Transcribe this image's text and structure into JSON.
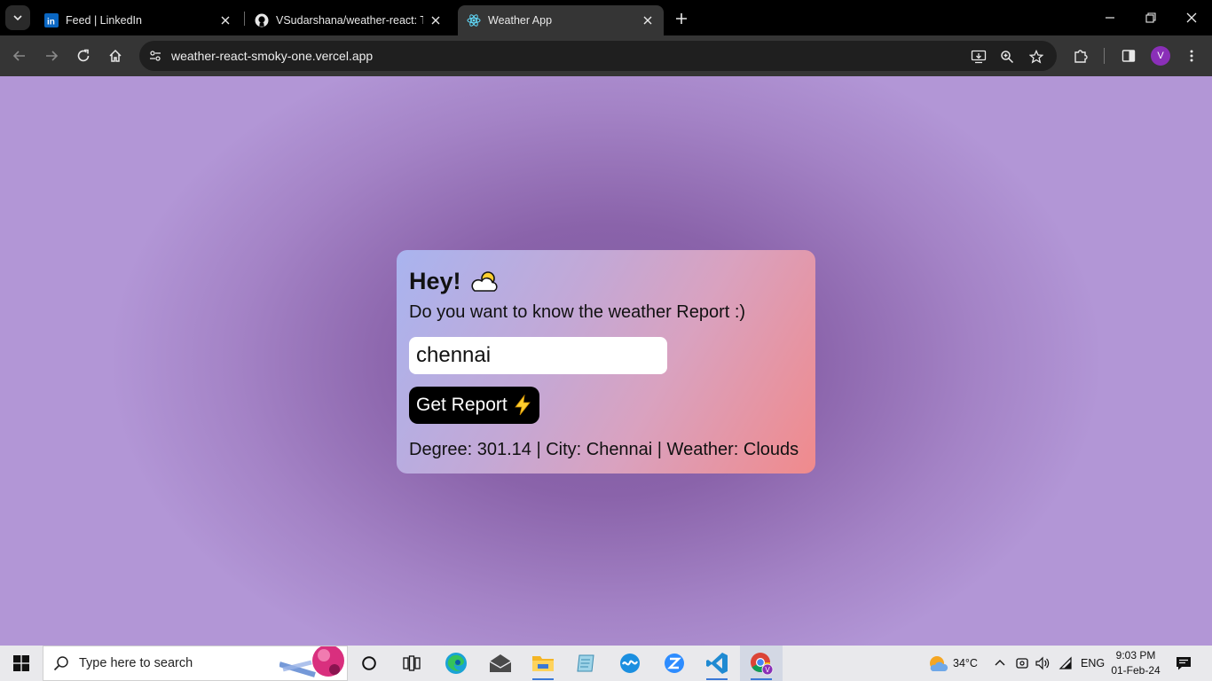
{
  "browser": {
    "tabs": [
      {
        "title": "Feed | LinkedIn",
        "active": false
      },
      {
        "title": "VSudarshana/weather-react: Th",
        "active": false
      },
      {
        "title": "Weather App",
        "active": true
      }
    ],
    "url": "weather-react-smoky-one.vercel.app",
    "profile_initial": "V"
  },
  "app": {
    "title": "Hey!",
    "subtitle": "Do you want to know the weather Report :)",
    "city_input_value": "chennai",
    "button_label": "Get Report",
    "result_text": "Degree: 301.14 | City: Chennai | Weather: Clouds"
  },
  "taskbar": {
    "search_placeholder": "Type here to search",
    "weather_temp": "34°C",
    "language": "ENG",
    "time": "9:03 PM",
    "date": "01-Feb-24"
  },
  "colors": {
    "accent_vscode": "#1f8ad2",
    "profile": "#8a2fb8",
    "card_gradient_start": "#a9b4ef",
    "card_gradient_end": "#f08a8c"
  }
}
